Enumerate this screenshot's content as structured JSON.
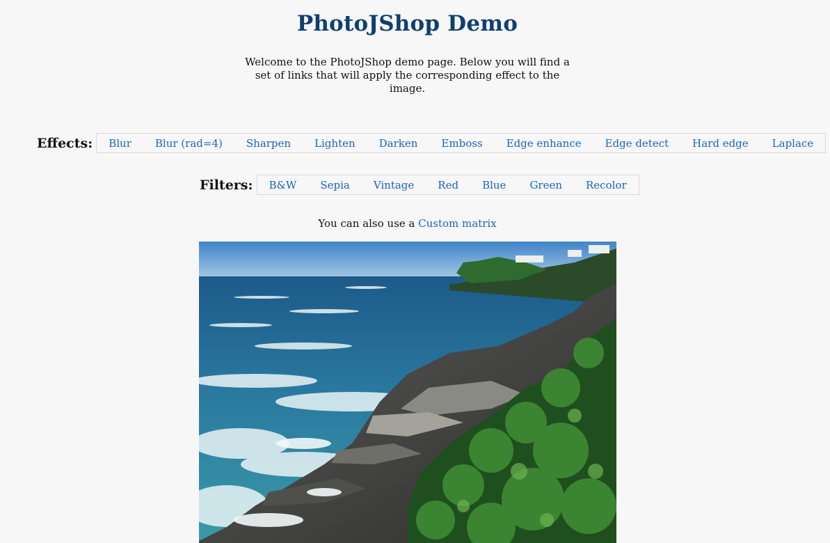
{
  "header": {
    "title": "PhotoJShop Demo",
    "intro": "Welcome to the PhotoJShop demo page. Below you will find a set of links that will apply the corresponding effect to the image."
  },
  "effects": {
    "label": "Effects:",
    "items": [
      "Blur",
      "Blur (rad=4)",
      "Sharpen",
      "Lighten",
      "Darken",
      "Emboss",
      "Edge enhance",
      "Edge detect",
      "Hard edge",
      "Laplace"
    ]
  },
  "filters": {
    "label": "Filters:",
    "items": [
      "B&W",
      "Sepia",
      "Vintage",
      "Red",
      "Blue",
      "Green",
      "Recolor"
    ]
  },
  "custom": {
    "prefix": "You can also use a ",
    "link": "Custom matrix"
  },
  "colors": {
    "title": "#0f3f72",
    "link": "#1c63c2",
    "background": "#f7f7f7"
  }
}
